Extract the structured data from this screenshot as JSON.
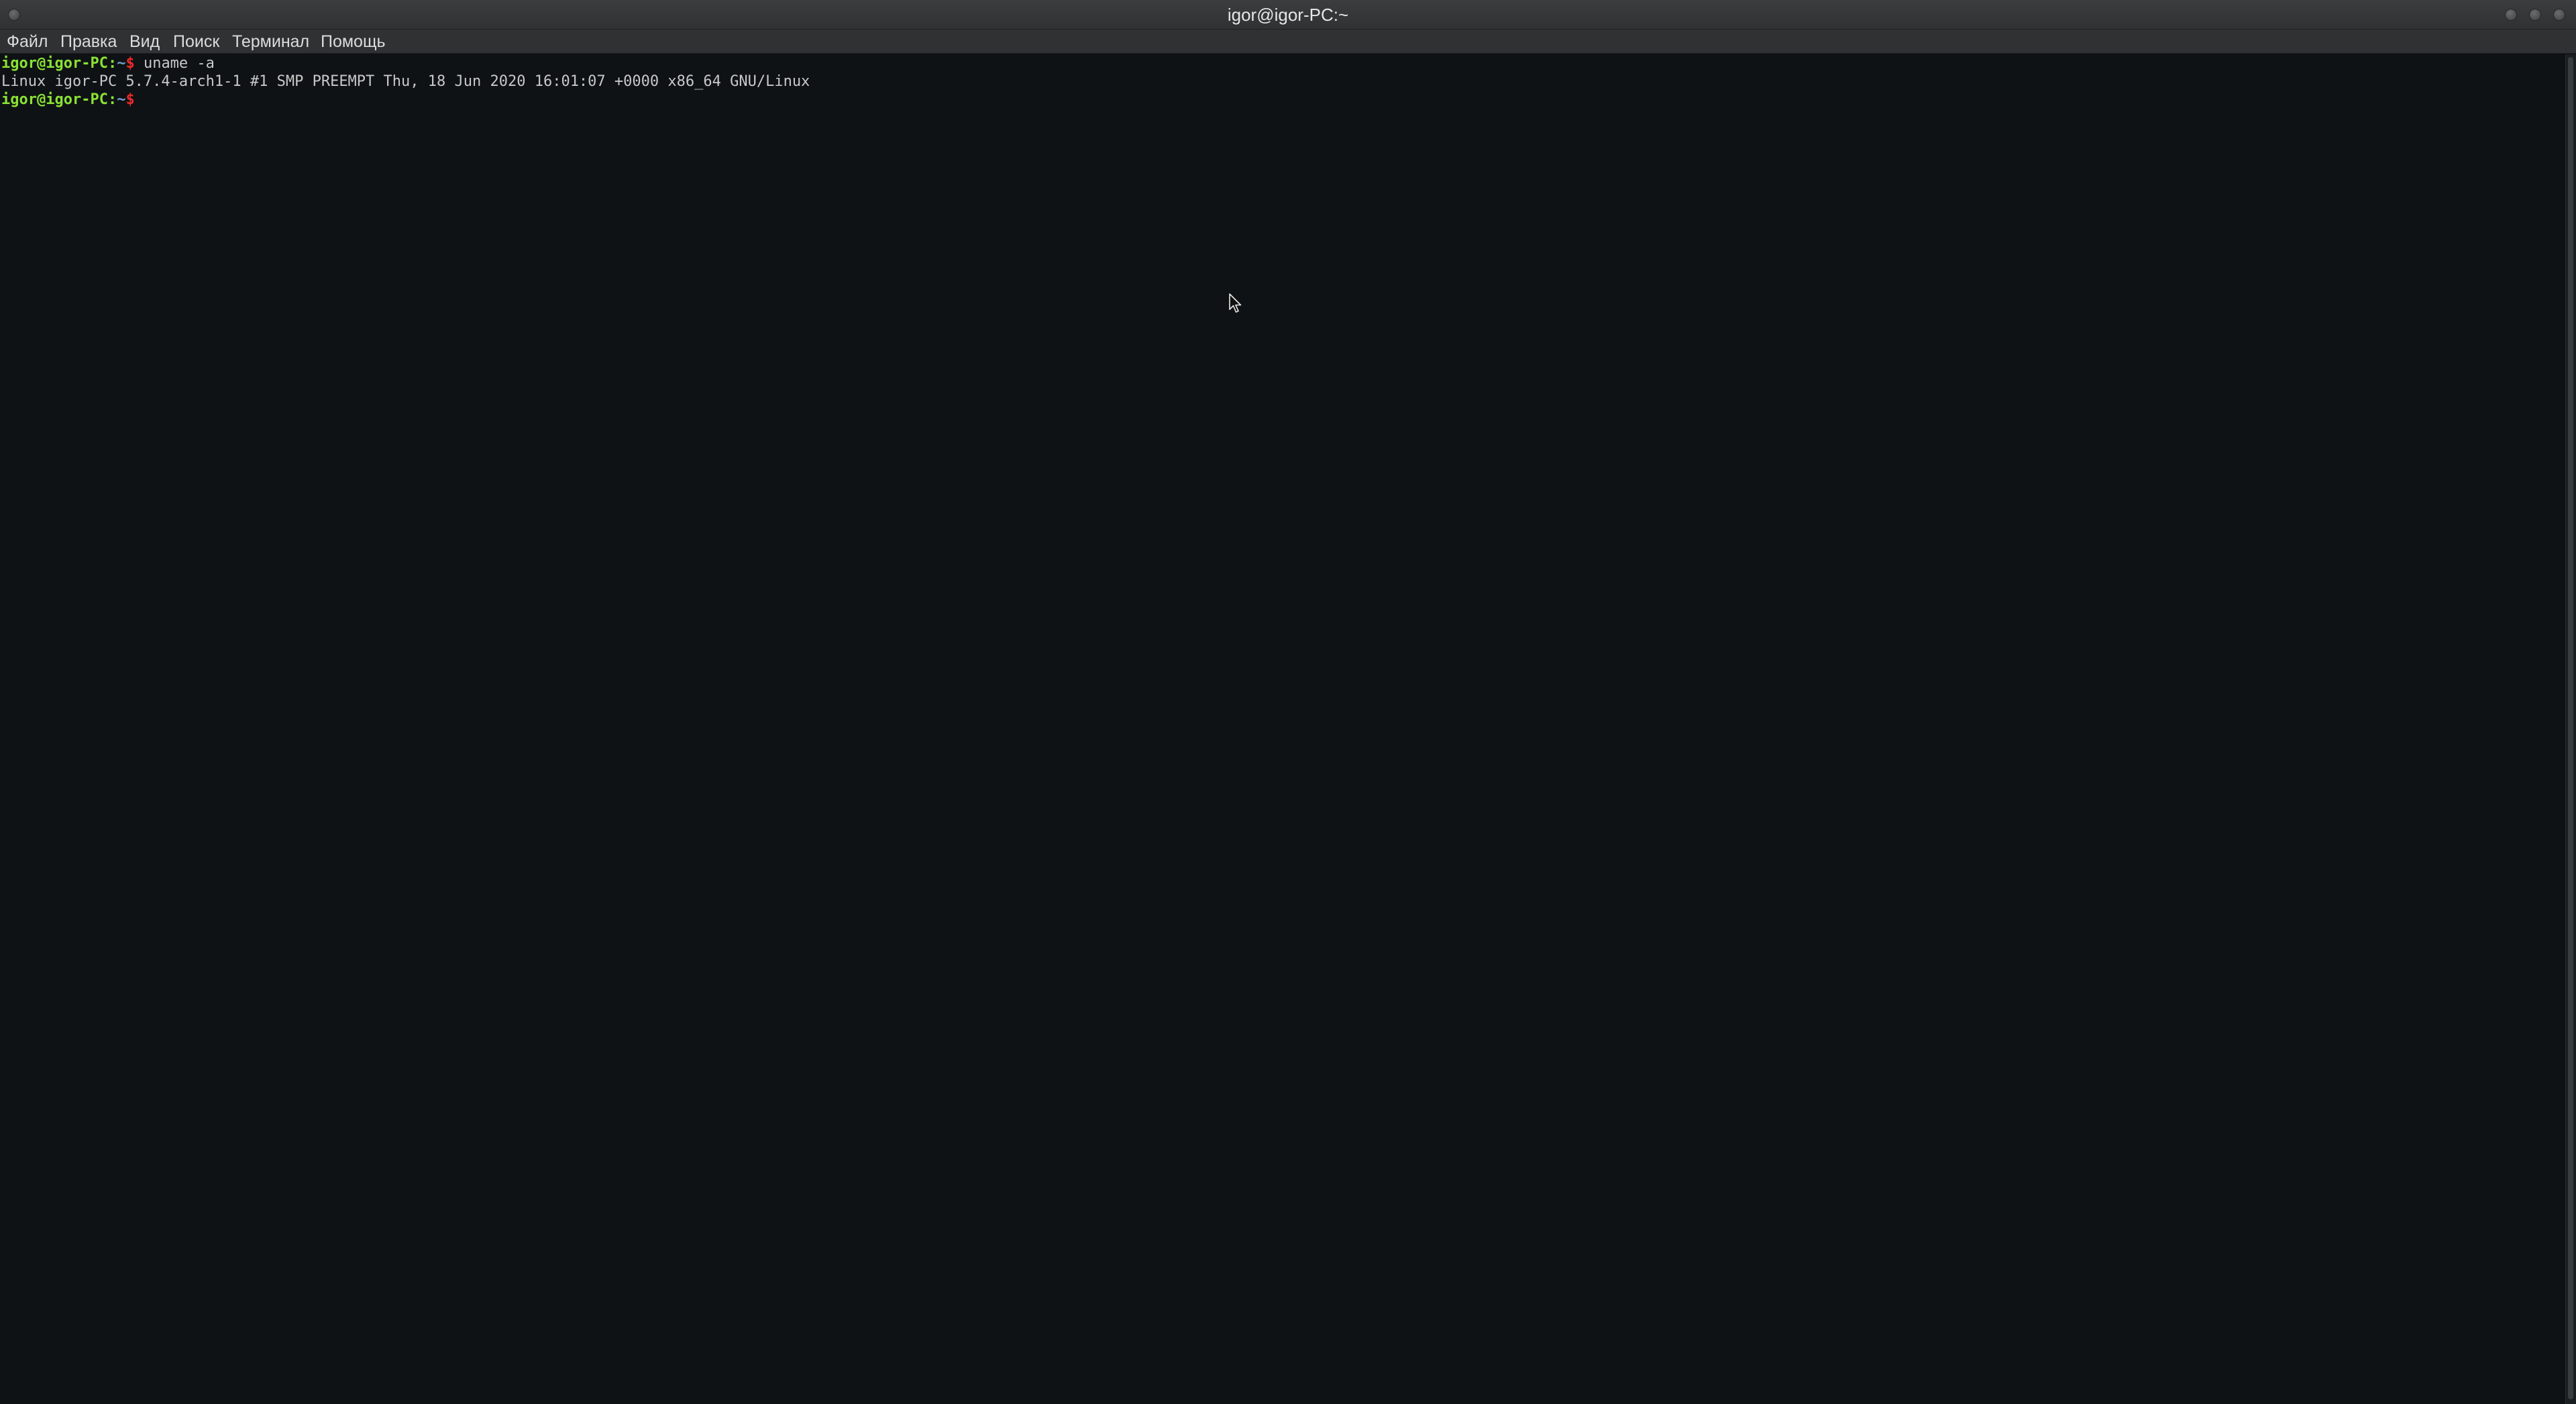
{
  "window": {
    "title": "igor@igor-PC:~"
  },
  "menu": {
    "items": [
      "Файл",
      "Правка",
      "Вид",
      "Поиск",
      "Терминал",
      "Помощь"
    ]
  },
  "terminal": {
    "lines": [
      {
        "user_host": "igor@igor-PC",
        "sep": ":",
        "path": "~",
        "symbol": "$",
        "command": " uname -a"
      },
      {
        "output": "Linux igor-PC 5.7.4-arch1-1 #1 SMP PREEMPT Thu, 18 Jun 2020 16:01:07 +0000 x86_64 GNU/Linux"
      },
      {
        "user_host": "igor@igor-PC",
        "sep": ":",
        "path": "~",
        "symbol": "$",
        "command": ""
      }
    ]
  },
  "colors": {
    "background": "#0e1214",
    "prompt_user": "#8ae234",
    "prompt_path": "#729fcf",
    "prompt_symbol": "#ef2929",
    "text": "#c8c8c8"
  },
  "icons": {
    "window_menu": "circle-button-icon",
    "minimize": "minimize-icon",
    "maximize": "maximize-icon",
    "close": "close-icon",
    "cursor": "mouse-pointer-icon"
  }
}
